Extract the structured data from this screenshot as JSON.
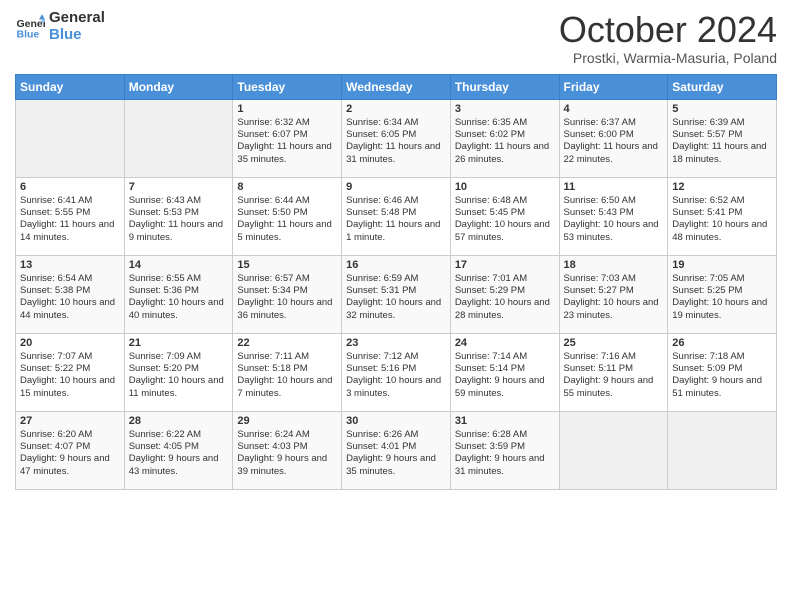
{
  "logo": {
    "line1": "General",
    "line2": "Blue"
  },
  "title": "October 2024",
  "subtitle": "Prostki, Warmia-Masuria, Poland",
  "weekdays": [
    "Sunday",
    "Monday",
    "Tuesday",
    "Wednesday",
    "Thursday",
    "Friday",
    "Saturday"
  ],
  "weeks": [
    [
      {
        "day": "",
        "info": ""
      },
      {
        "day": "",
        "info": ""
      },
      {
        "day": "1",
        "info": "Sunrise: 6:32 AM\nSunset: 6:07 PM\nDaylight: 11 hours and 35 minutes."
      },
      {
        "day": "2",
        "info": "Sunrise: 6:34 AM\nSunset: 6:05 PM\nDaylight: 11 hours and 31 minutes."
      },
      {
        "day": "3",
        "info": "Sunrise: 6:35 AM\nSunset: 6:02 PM\nDaylight: 11 hours and 26 minutes."
      },
      {
        "day": "4",
        "info": "Sunrise: 6:37 AM\nSunset: 6:00 PM\nDaylight: 11 hours and 22 minutes."
      },
      {
        "day": "5",
        "info": "Sunrise: 6:39 AM\nSunset: 5:57 PM\nDaylight: 11 hours and 18 minutes."
      }
    ],
    [
      {
        "day": "6",
        "info": "Sunrise: 6:41 AM\nSunset: 5:55 PM\nDaylight: 11 hours and 14 minutes."
      },
      {
        "day": "7",
        "info": "Sunrise: 6:43 AM\nSunset: 5:53 PM\nDaylight: 11 hours and 9 minutes."
      },
      {
        "day": "8",
        "info": "Sunrise: 6:44 AM\nSunset: 5:50 PM\nDaylight: 11 hours and 5 minutes."
      },
      {
        "day": "9",
        "info": "Sunrise: 6:46 AM\nSunset: 5:48 PM\nDaylight: 11 hours and 1 minute."
      },
      {
        "day": "10",
        "info": "Sunrise: 6:48 AM\nSunset: 5:45 PM\nDaylight: 10 hours and 57 minutes."
      },
      {
        "day": "11",
        "info": "Sunrise: 6:50 AM\nSunset: 5:43 PM\nDaylight: 10 hours and 53 minutes."
      },
      {
        "day": "12",
        "info": "Sunrise: 6:52 AM\nSunset: 5:41 PM\nDaylight: 10 hours and 48 minutes."
      }
    ],
    [
      {
        "day": "13",
        "info": "Sunrise: 6:54 AM\nSunset: 5:38 PM\nDaylight: 10 hours and 44 minutes."
      },
      {
        "day": "14",
        "info": "Sunrise: 6:55 AM\nSunset: 5:36 PM\nDaylight: 10 hours and 40 minutes."
      },
      {
        "day": "15",
        "info": "Sunrise: 6:57 AM\nSunset: 5:34 PM\nDaylight: 10 hours and 36 minutes."
      },
      {
        "day": "16",
        "info": "Sunrise: 6:59 AM\nSunset: 5:31 PM\nDaylight: 10 hours and 32 minutes."
      },
      {
        "day": "17",
        "info": "Sunrise: 7:01 AM\nSunset: 5:29 PM\nDaylight: 10 hours and 28 minutes."
      },
      {
        "day": "18",
        "info": "Sunrise: 7:03 AM\nSunset: 5:27 PM\nDaylight: 10 hours and 23 minutes."
      },
      {
        "day": "19",
        "info": "Sunrise: 7:05 AM\nSunset: 5:25 PM\nDaylight: 10 hours and 19 minutes."
      }
    ],
    [
      {
        "day": "20",
        "info": "Sunrise: 7:07 AM\nSunset: 5:22 PM\nDaylight: 10 hours and 15 minutes."
      },
      {
        "day": "21",
        "info": "Sunrise: 7:09 AM\nSunset: 5:20 PM\nDaylight: 10 hours and 11 minutes."
      },
      {
        "day": "22",
        "info": "Sunrise: 7:11 AM\nSunset: 5:18 PM\nDaylight: 10 hours and 7 minutes."
      },
      {
        "day": "23",
        "info": "Sunrise: 7:12 AM\nSunset: 5:16 PM\nDaylight: 10 hours and 3 minutes."
      },
      {
        "day": "24",
        "info": "Sunrise: 7:14 AM\nSunset: 5:14 PM\nDaylight: 9 hours and 59 minutes."
      },
      {
        "day": "25",
        "info": "Sunrise: 7:16 AM\nSunset: 5:11 PM\nDaylight: 9 hours and 55 minutes."
      },
      {
        "day": "26",
        "info": "Sunrise: 7:18 AM\nSunset: 5:09 PM\nDaylight: 9 hours and 51 minutes."
      }
    ],
    [
      {
        "day": "27",
        "info": "Sunrise: 6:20 AM\nSunset: 4:07 PM\nDaylight: 9 hours and 47 minutes."
      },
      {
        "day": "28",
        "info": "Sunrise: 6:22 AM\nSunset: 4:05 PM\nDaylight: 9 hours and 43 minutes."
      },
      {
        "day": "29",
        "info": "Sunrise: 6:24 AM\nSunset: 4:03 PM\nDaylight: 9 hours and 39 minutes."
      },
      {
        "day": "30",
        "info": "Sunrise: 6:26 AM\nSunset: 4:01 PM\nDaylight: 9 hours and 35 minutes."
      },
      {
        "day": "31",
        "info": "Sunrise: 6:28 AM\nSunset: 3:59 PM\nDaylight: 9 hours and 31 minutes."
      },
      {
        "day": "",
        "info": ""
      },
      {
        "day": "",
        "info": ""
      }
    ]
  ]
}
